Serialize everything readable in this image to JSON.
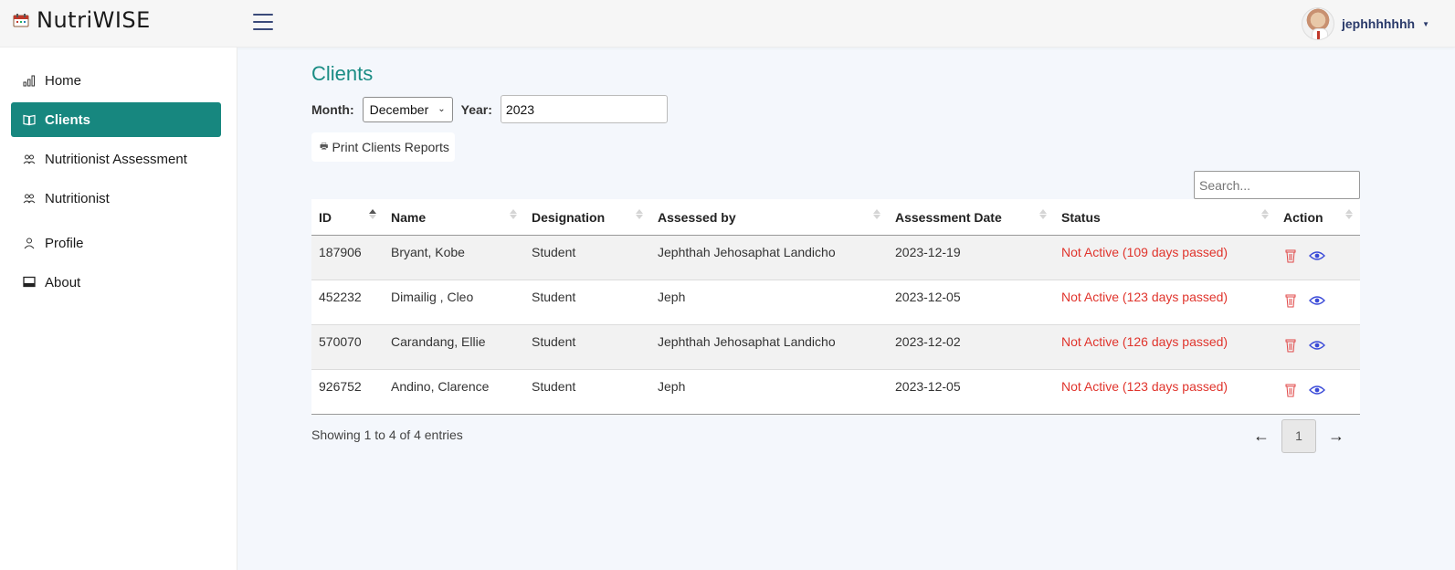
{
  "app": {
    "name": "NutriWISE"
  },
  "user": {
    "name": "jephhhhhhh"
  },
  "sidebar": {
    "items": [
      {
        "label": "Home",
        "icon": "chart-bars-icon",
        "active": false
      },
      {
        "label": "Clients",
        "icon": "book-open-icon",
        "active": true
      },
      {
        "label": "Nutritionist Assessment",
        "icon": "users-icon",
        "active": false
      },
      {
        "label": "Nutritionist",
        "icon": "users-icon",
        "active": false
      },
      {
        "label": "Profile",
        "icon": "person-icon",
        "active": false
      },
      {
        "label": "About",
        "icon": "monitor-icon",
        "active": false
      }
    ]
  },
  "main": {
    "title": "Clients",
    "filters": {
      "month_label": "Month:",
      "month_value": "December",
      "year_label": "Year:",
      "year_value": "2023"
    },
    "print_label": "Print Clients Reports",
    "search_placeholder": "Search...",
    "table": {
      "columns": [
        "ID",
        "Name",
        "Designation",
        "Assessed by",
        "Assessment Date",
        "Status",
        "Action"
      ],
      "rows": [
        {
          "id": "187906",
          "name": "Bryant, Kobe",
          "designation": "Student",
          "assessed_by": "Jephthah Jehosaphat Landicho",
          "date": "2023-12-19",
          "status": "Not Active (109 days passed)"
        },
        {
          "id": "452232",
          "name": "Dimailig , Cleo",
          "designation": "Student",
          "assessed_by": "Jeph",
          "date": "2023-12-05",
          "status": "Not Active (123 days passed)"
        },
        {
          "id": "570070",
          "name": "Carandang, Ellie",
          "designation": "Student",
          "assessed_by": "Jephthah Jehosaphat Landicho",
          "date": "2023-12-02",
          "status": "Not Active (126 days passed)"
        },
        {
          "id": "926752",
          "name": "Andino, Clarence",
          "designation": "Student",
          "assessed_by": "Jeph",
          "date": "2023-12-05",
          "status": "Not Active (123 days passed)"
        }
      ]
    },
    "info": "Showing 1 to 4 of 4 entries",
    "pagination": {
      "prev": "←",
      "current": "1",
      "next": "→"
    }
  },
  "colors": {
    "accent": "#17877f",
    "title": "#1a8c84",
    "status_inactive": "#e0342c",
    "delete_icon": "#e04848",
    "view_icon": "#3b4bd8"
  }
}
